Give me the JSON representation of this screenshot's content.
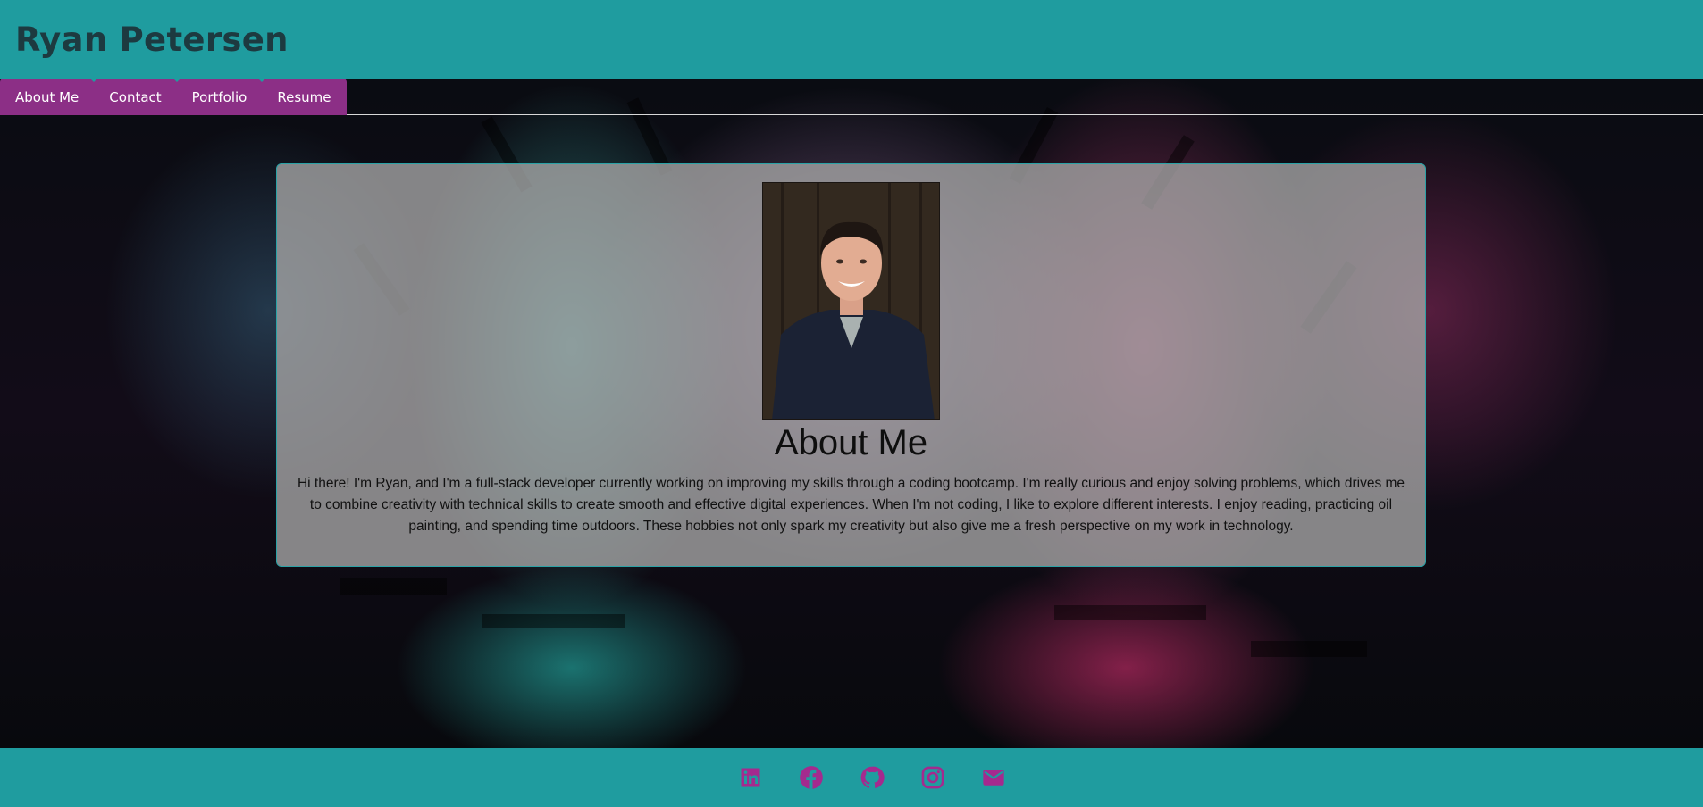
{
  "header": {
    "title": "Ryan Petersen"
  },
  "nav": {
    "items": [
      {
        "label": "About Me"
      },
      {
        "label": "Contact"
      },
      {
        "label": "Portfolio"
      },
      {
        "label": "Resume"
      }
    ]
  },
  "about": {
    "heading": "About Me",
    "body": "Hi there! I'm Ryan, and I'm a full-stack developer currently working on improving my skills through a coding bootcamp. I'm really curious and enjoy solving problems, which drives me to combine creativity with technical skills to create smooth and effective digital experiences. When I'm not coding, I like to explore different interests. I enjoy reading, practicing oil painting, and spending time outdoors. These hobbies not only spark my creativity but also give me a fresh perspective on my work in technology.",
    "photo_icon": "profile-photo"
  },
  "footer": {
    "icons": [
      "linkedin-icon",
      "facebook-icon",
      "github-icon",
      "instagram-icon",
      "email-icon"
    ]
  },
  "colors": {
    "header_bg": "#1f9c9f",
    "nav_bg": "#8c2f86",
    "title_text": "#1d3a40",
    "icon_color": "#a42a8e",
    "card_bg": "#a8a8a8"
  }
}
